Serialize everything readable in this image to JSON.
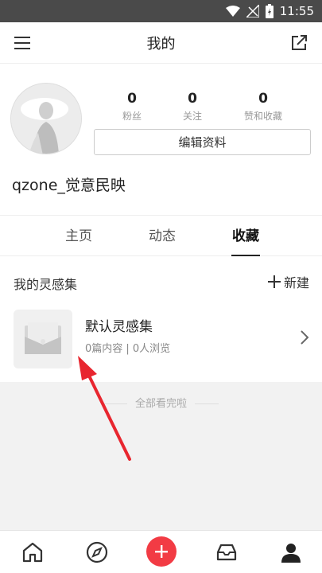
{
  "status_bar": {
    "time": "11:55",
    "icons": [
      "wifi-icon",
      "no-signal-icon",
      "battery-charging-icon"
    ]
  },
  "header": {
    "title": "我的",
    "left_icon": "menu-icon",
    "right_icon": "share-icon"
  },
  "profile": {
    "stats": [
      {
        "value": "0",
        "label": "粉丝"
      },
      {
        "value": "0",
        "label": "关注"
      },
      {
        "value": "0",
        "label": "赞和收藏"
      }
    ],
    "edit_label": "编辑资料",
    "username": "qzone_觉意民映"
  },
  "tabs": [
    {
      "label": "主页",
      "active": false
    },
    {
      "label": "动态",
      "active": false
    },
    {
      "label": "收藏",
      "active": true
    }
  ],
  "inspiration": {
    "title": "我的灵感集",
    "new_label": "新建",
    "items": [
      {
        "name": "默认灵感集",
        "meta": "0篇内容 | 0人浏览"
      }
    ]
  },
  "end_note": "全部看完啦",
  "bottom_nav": [
    "home-icon",
    "compass-icon",
    "add-icon",
    "inbox-icon",
    "profile-icon"
  ],
  "colors": {
    "accent": "#f23b44",
    "status_bar": "#4a4a4a",
    "annotation_arrow": "#e8262f"
  }
}
